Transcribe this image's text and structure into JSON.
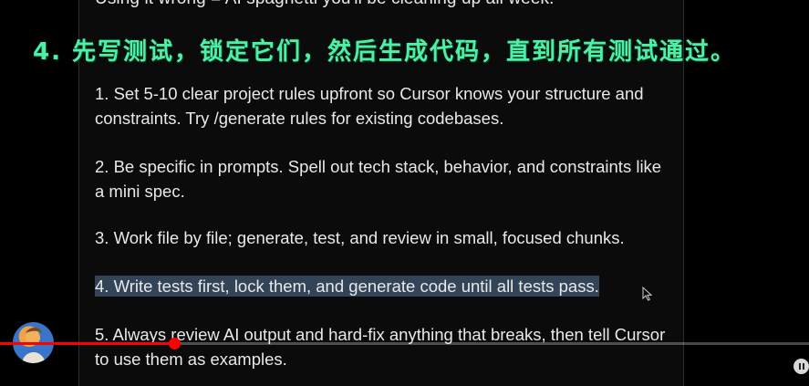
{
  "post": {
    "top_partial_line": "Using it wrong = AI spaghetti you'll be cleaning up all week.",
    "tips": [
      "1. Set 5-10 clear project rules upfront so Cursor knows your structure and constraints. Try /generate rules for existing codebases.",
      "2. Be specific in prompts. Spell out tech stack, behavior, and constraints like a mini spec.",
      "3. Work file by file; generate, test, and review in small, focused chunks.",
      "4. Write tests first, lock them, and generate code until all tests pass.",
      "5. Always review AI output and hard-fix anything that breaks, then tell Cursor to use them as examples."
    ]
  },
  "overlay": {
    "subtitle": "4. 先写测试，锁定它们，然后生成代码，直到所有测试通过。"
  },
  "player": {
    "progress_fraction": 0.215,
    "progress_color": "#ff0000",
    "pause_icon": "pause-icon",
    "avatar_icon": "channel-avatar"
  },
  "colors": {
    "background": "#000000",
    "text": "#e7e9ea",
    "subtitle": "#4ef0a6",
    "highlight": "#344458"
  }
}
